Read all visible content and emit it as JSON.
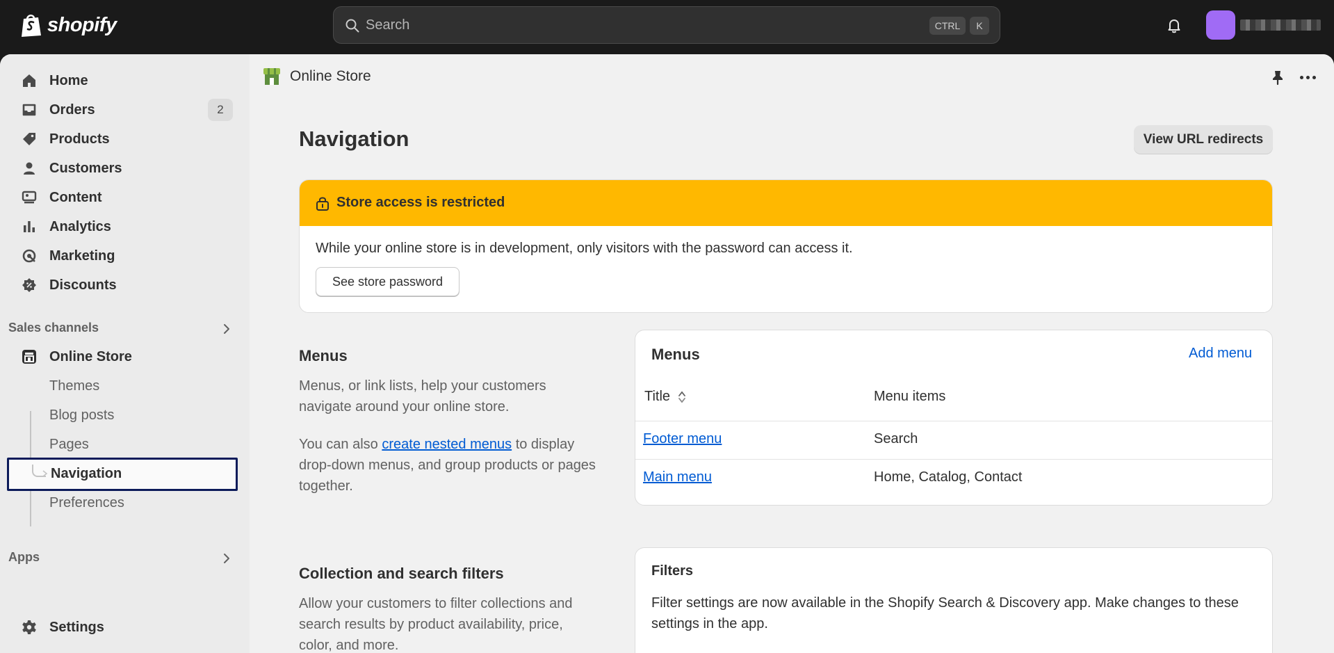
{
  "app": {
    "brand": "shopify"
  },
  "search": {
    "placeholder": "Search",
    "shortcut_ctrl": "CTRL",
    "shortcut_key": "K"
  },
  "sidebar": {
    "items": [
      {
        "label": "Home"
      },
      {
        "label": "Orders",
        "badge": "2"
      },
      {
        "label": "Products"
      },
      {
        "label": "Customers"
      },
      {
        "label": "Content"
      },
      {
        "label": "Analytics"
      },
      {
        "label": "Marketing"
      },
      {
        "label": "Discounts"
      }
    ],
    "sales_channels_label": "Sales channels",
    "online_store": {
      "label": "Online Store"
    },
    "sub_items": [
      {
        "label": "Themes"
      },
      {
        "label": "Blog posts"
      },
      {
        "label": "Pages"
      },
      {
        "label": "Navigation"
      },
      {
        "label": "Preferences"
      }
    ],
    "apps_label": "Apps",
    "settings_label": "Settings"
  },
  "breadcrumb": {
    "label": "Online Store"
  },
  "page": {
    "title": "Navigation",
    "redirects_button": "View URL redirects"
  },
  "banner": {
    "title": "Store access is restricted",
    "text": "While your online store is in development, only visitors with the password can access it.",
    "button": "See store password"
  },
  "menus_section": {
    "title": "Menus",
    "description": "Menus, or link lists, help your customers navigate around your online store.",
    "text_before_link": "You can also ",
    "link": "create nested menus",
    "text_after_link": " to display drop-down menus, and group products or pages together."
  },
  "menus_card": {
    "title": "Menus",
    "add_menu": "Add menu",
    "col_title": "Title",
    "col_items": "Menu items",
    "rows": [
      {
        "title": "Footer menu",
        "items": "Search"
      },
      {
        "title": "Main menu",
        "items": "Home, Catalog, Contact"
      }
    ]
  },
  "filters_section": {
    "title": "Collection and search filters",
    "description": "Allow your customers to filter collections and search results by product availability, price, color, and more."
  },
  "filters_card": {
    "title": "Filters",
    "text": "Filter settings are now available in the Shopify Search & Discovery app. Make changes to these settings in the app."
  },
  "colors": {
    "accent": "#005bd3",
    "warning": "#ffb800",
    "topbar": "#1a1a1a",
    "avatar": "#a06bf5",
    "selected_outline": "#0c1b5a"
  }
}
